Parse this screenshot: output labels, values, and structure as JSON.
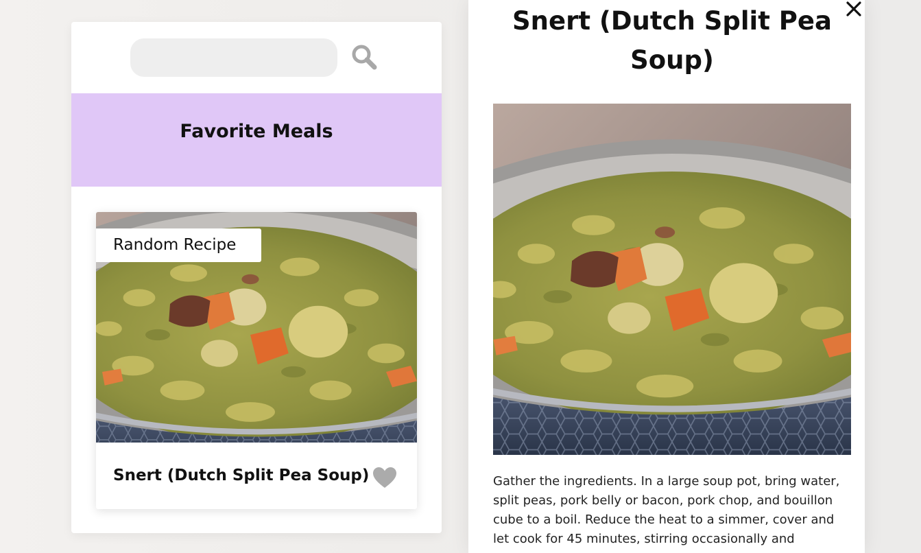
{
  "search": {
    "value": "",
    "placeholder": "",
    "icon": "search-icon"
  },
  "favorites": {
    "title": "Favorite Meals"
  },
  "random_meal": {
    "tag": "Random Recipe",
    "name": "Snert (Dutch Split Pea Soup)",
    "favorite_icon": "heart-icon",
    "favorited": false
  },
  "detail": {
    "title": "Snert (Dutch Split Pea Soup)",
    "close_icon": "close-icon",
    "instructions": "Gather the ingredients. In a large soup pot, bring water, split peas, pork belly or bacon, pork chop, and bouillon cube to a boil. Reduce the heat to a simmer, cover and let cook for 45 minutes, stirring occasionally and"
  },
  "colors": {
    "banner": "#e0c7f7",
    "icon_gray": "#a8a8a8",
    "text": "#111111",
    "page_background": "#efedeb"
  }
}
